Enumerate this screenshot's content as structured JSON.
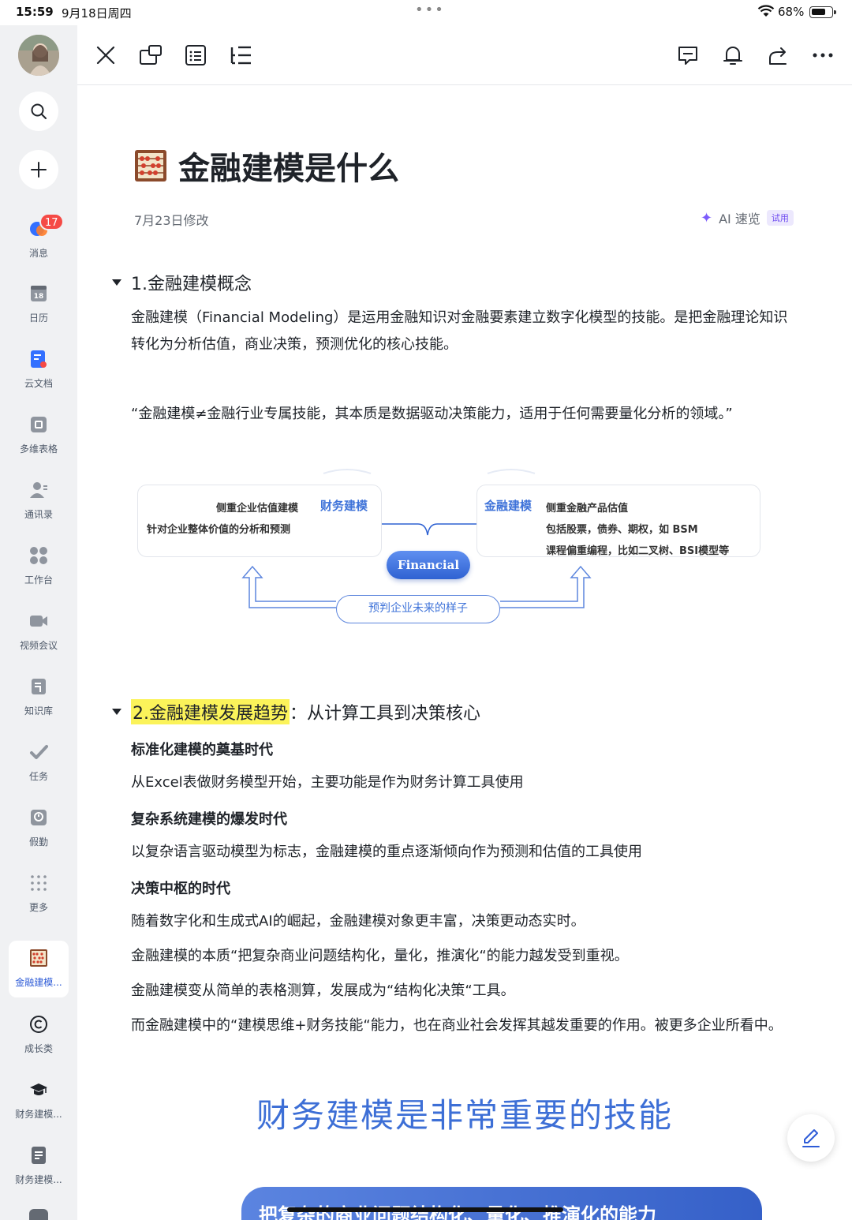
{
  "status": {
    "time": "15:59",
    "date": "9月18日周四",
    "battery": "68%"
  },
  "sidebar": {
    "badge_count": "17",
    "items": [
      {
        "label": "消息",
        "icon": "chat-bubble-icon"
      },
      {
        "label": "日历",
        "icon": "calendar-icon",
        "day": "18"
      },
      {
        "label": "云文档",
        "icon": "cloud-doc-icon"
      },
      {
        "label": "多维表格",
        "icon": "base-table-icon"
      },
      {
        "label": "通讯录",
        "icon": "contacts-icon"
      },
      {
        "label": "工作台",
        "icon": "workplace-icon"
      },
      {
        "label": "视频会议",
        "icon": "video-meeting-icon"
      },
      {
        "label": "知识库",
        "icon": "wiki-icon"
      },
      {
        "label": "任务",
        "icon": "task-icon"
      },
      {
        "label": "假勤",
        "icon": "attendance-icon"
      },
      {
        "label": "更多",
        "icon": "more-grid-icon"
      },
      {
        "label": "金融建模...",
        "icon": "abacus-icon",
        "active": true
      },
      {
        "label": "成长类",
        "icon": "copyright-icon"
      },
      {
        "label": "财务建模...",
        "icon": "graduation-cap-icon"
      },
      {
        "label": "财务建模...",
        "icon": "doc-icon"
      }
    ]
  },
  "document": {
    "title": "金融建模是什么",
    "modified": "7月23日修改",
    "ai": {
      "label": "AI 速览",
      "tag": "试用"
    },
    "section1": {
      "heading": "1.金融建模概念",
      "para1": "金融建模（Financial Modeling）是运用金融知识对金融要素建立数字化模型的技能。是把金融理论知识转化为分析估值，商业决策，预测优化的核心技能。",
      "para2": "“金融建模≠金融行业专属技能，其本质是数据驱动决策能力，适用于任何需要量化分析的领域。”"
    },
    "diagram": {
      "left_title": "财务建模",
      "left_line1": "侧重企业估值建模",
      "left_line2": "针对企业整体价值的分析和预测",
      "right_title": "金融建模",
      "right_line1": "侧重金融产品估值",
      "right_line2": "包括股票，债券、期权，如 BSM",
      "right_line3": "课程偏重编程，比如二叉树、BSI模型等",
      "center": "Financial",
      "bottom": "预判企业未来的样子"
    },
    "section2": {
      "heading_highlight": "2.金融建模发展趋势",
      "heading_rest": "：从计算工具到决策核心",
      "sub1": "标准化建模的奠基时代",
      "text1": "从Excel表做财务模型开始，主要功能是作为财务计算工具使用",
      "sub2": "复杂系统建模的爆发时代",
      "text2": "以复杂语言驱动模型为标志，金融建模的重点逐渐倾向作为预测和估值的工具使用",
      "sub3": "决策中枢的时代",
      "text3": "随着数字化和生成式AI的崛起，金融建模对象更丰富，决策更动态实时。",
      "text4": "金融建模的本质“把复杂商业问题结构化，量化，推演化“的能力越发受到重视。",
      "text5": "金融建模变从简单的表格测算，发展成为“结构化决策“工具。",
      "text6": "而金融建模中的“建模思维+财务技能“能力，也在商业社会发挥其越发重要的作用。被更多企业所看中。"
    },
    "banner_text": "财务建模是非常重要的技能",
    "banner_bottom": "把复杂的商业问题结构化、量化、推演化的能力"
  }
}
